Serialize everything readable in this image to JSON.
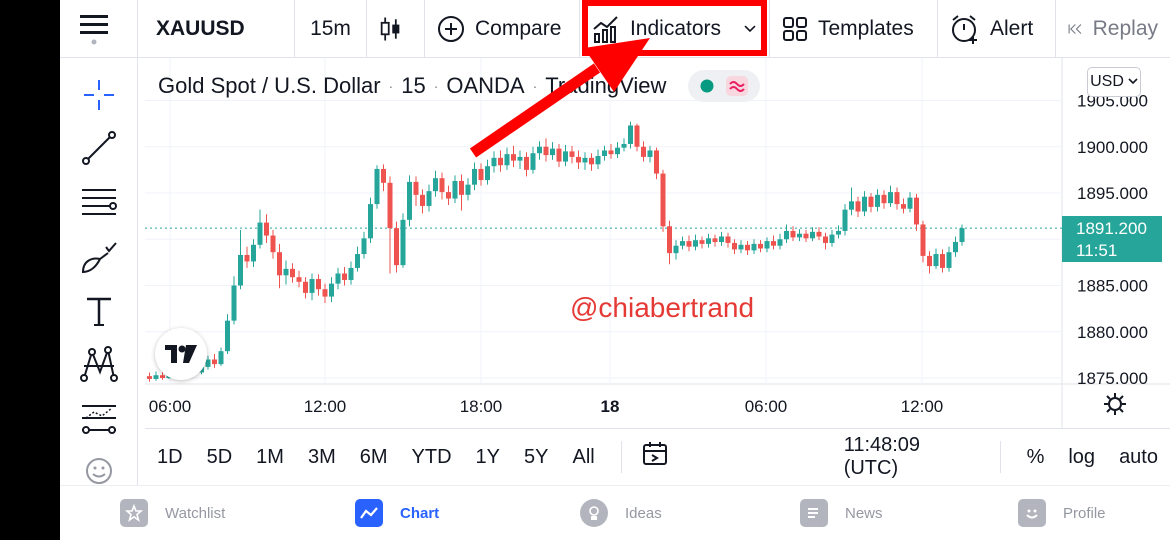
{
  "toolbar": {
    "symbol": "XAUUSD",
    "interval": "15m",
    "compare_label": "Compare",
    "indicators_label": "Indicators",
    "templates_label": "Templates",
    "alert_label": "Alert",
    "replay_label": "Replay"
  },
  "legend": {
    "name": "Gold Spot / U.S. Dollar",
    "interval": "15",
    "exchange": "OANDA",
    "source": "TradingView"
  },
  "currency": "USD",
  "price_axis": [
    "1905.000",
    "1900.000",
    "1895.000",
    "1891.200",
    "1885.000",
    "1880.000",
    "1875.000"
  ],
  "price_axis_ticks": [
    "1905.000",
    "1900.000",
    "1895.000",
    "1885.000",
    "1880.000",
    "1875.000"
  ],
  "time_axis": [
    "06:00",
    "12:00",
    "18:00",
    "18",
    "06:00",
    "12:00"
  ],
  "last_price": {
    "price": "1891.200",
    "countdown": "11:51"
  },
  "watermark": "@chiabertrand",
  "range_buttons": [
    "1D",
    "5D",
    "1M",
    "3M",
    "6M",
    "YTD",
    "1Y",
    "5Y",
    "All"
  ],
  "clock": "11:48:09 (UTC)",
  "scale_options": [
    "%",
    "log",
    "auto"
  ],
  "bottom_nav": [
    "Watchlist",
    "Chart",
    "Ideas",
    "News",
    "Profile"
  ],
  "colors": {
    "up": "#26a69a",
    "down": "#ef5350",
    "accent": "#2962ff",
    "annotation": "#ff0000"
  },
  "icons": [
    "menu-icon",
    "candlestick-icon",
    "plus-circle-icon",
    "indicators-icon",
    "chevron-down-icon",
    "templates-icon",
    "alarm-icon",
    "replay-icon",
    "crosshair-icon",
    "trend-line-icon",
    "fib-icon",
    "brush-icon",
    "text-icon",
    "pattern-icon",
    "prediction-icon",
    "emoji-icon",
    "tradingview-logo-icon",
    "gear-icon",
    "date-range-icon"
  ],
  "chart_data": {
    "type": "candlestick",
    "title": "Gold Spot / U.S. Dollar",
    "x_ticks": [
      "06:00",
      "12:00",
      "18:00",
      "18",
      "06:00",
      "12:00"
    ],
    "ylim": [
      1874,
      1907
    ],
    "y_ticks": [
      1875,
      1880,
      1885,
      1890,
      1895,
      1900,
      1905
    ],
    "last": 1891.2,
    "candles": [
      [
        1875.2,
        1874.9,
        1875.6,
        1874.6
      ],
      [
        1874.9,
        1875.3,
        1875.7,
        1874.7
      ],
      [
        1875.3,
        1875.0,
        1875.8,
        1874.8
      ],
      [
        1875.0,
        1875.5,
        1876.0,
        1874.9
      ],
      [
        1875.5,
        1875.8,
        1876.2,
        1875.2
      ],
      [
        1875.8,
        1875.4,
        1876.1,
        1875.1
      ],
      [
        1875.4,
        1875.9,
        1876.3,
        1875.2
      ],
      [
        1875.9,
        1875.6,
        1876.4,
        1875.3
      ],
      [
        1875.6,
        1876.2,
        1876.8,
        1875.4
      ],
      [
        1876.2,
        1877.0,
        1877.4,
        1875.9
      ],
      [
        1877.0,
        1876.5,
        1877.6,
        1876.1
      ],
      [
        1876.5,
        1877.9,
        1878.3,
        1876.3
      ],
      [
        1877.9,
        1881.2,
        1881.9,
        1877.6
      ],
      [
        1881.2,
        1885.0,
        1886.0,
        1880.8
      ],
      [
        1885.0,
        1888.3,
        1891.0,
        1884.6
      ],
      [
        1888.3,
        1887.6,
        1889.2,
        1886.9
      ],
      [
        1887.6,
        1889.4,
        1890.0,
        1887.0
      ],
      [
        1889.4,
        1891.8,
        1893.2,
        1889.0
      ],
      [
        1891.8,
        1890.4,
        1892.7,
        1889.6
      ],
      [
        1890.4,
        1888.6,
        1891.0,
        1887.9
      ],
      [
        1888.6,
        1886.1,
        1889.5,
        1884.7
      ],
      [
        1886.1,
        1886.8,
        1887.7,
        1885.1
      ],
      [
        1886.8,
        1885.9,
        1887.4,
        1885.3
      ],
      [
        1885.9,
        1885.4,
        1886.6,
        1884.8
      ],
      [
        1885.4,
        1884.2,
        1885.9,
        1883.6
      ],
      [
        1884.2,
        1885.7,
        1886.3,
        1883.4
      ],
      [
        1885.7,
        1884.6,
        1886.2,
        1883.9
      ],
      [
        1884.6,
        1883.8,
        1885.2,
        1883.1
      ],
      [
        1883.8,
        1885.2,
        1885.9,
        1883.2
      ],
      [
        1885.2,
        1886.3,
        1886.9,
        1884.6
      ],
      [
        1886.3,
        1885.6,
        1887.0,
        1885.0
      ],
      [
        1885.6,
        1886.9,
        1887.6,
        1885.1
      ],
      [
        1886.9,
        1888.4,
        1889.2,
        1886.5
      ],
      [
        1888.4,
        1890.1,
        1890.8,
        1887.9
      ],
      [
        1890.1,
        1893.8,
        1894.5,
        1889.6
      ],
      [
        1893.8,
        1897.6,
        1898.0,
        1893.3
      ],
      [
        1897.6,
        1896.1,
        1898.1,
        1895.2
      ],
      [
        1896.1,
        1891.2,
        1896.8,
        1886.3
      ],
      [
        1891.2,
        1887.2,
        1891.9,
        1886.4
      ],
      [
        1887.2,
        1892.1,
        1892.8,
        1886.9
      ],
      [
        1892.1,
        1896.2,
        1896.9,
        1891.4
      ],
      [
        1896.2,
        1894.8,
        1896.8,
        1893.6
      ],
      [
        1894.8,
        1893.6,
        1895.4,
        1892.8
      ],
      [
        1893.6,
        1895.2,
        1895.9,
        1893.0
      ],
      [
        1895.2,
        1896.6,
        1897.4,
        1894.6
      ],
      [
        1896.6,
        1895.1,
        1897.2,
        1894.3
      ],
      [
        1895.1,
        1894.4,
        1895.8,
        1893.7
      ],
      [
        1894.4,
        1896.3,
        1896.9,
        1893.9
      ],
      [
        1896.3,
        1894.8,
        1897.0,
        1893.1
      ],
      [
        1894.8,
        1895.9,
        1896.6,
        1894.2
      ],
      [
        1895.9,
        1897.6,
        1898.3,
        1895.3
      ],
      [
        1897.6,
        1896.4,
        1898.2,
        1895.8
      ],
      [
        1896.4,
        1897.9,
        1898.6,
        1895.9
      ],
      [
        1897.9,
        1898.8,
        1899.5,
        1897.2
      ],
      [
        1898.8,
        1898.0,
        1899.6,
        1897.3
      ],
      [
        1898.0,
        1899.2,
        1899.9,
        1897.5
      ],
      [
        1899.2,
        1898.5,
        1900.1,
        1897.8
      ],
      [
        1898.5,
        1898.9,
        1899.6,
        1897.6
      ],
      [
        1898.9,
        1897.5,
        1899.4,
        1896.8
      ],
      [
        1897.5,
        1899.3,
        1900.0,
        1897.1
      ],
      [
        1899.3,
        1900.0,
        1900.6,
        1898.6
      ],
      [
        1900.0,
        1899.1,
        1900.9,
        1898.4
      ],
      [
        1899.1,
        1899.8,
        1900.5,
        1898.6
      ],
      [
        1899.8,
        1898.4,
        1900.3,
        1897.8
      ],
      [
        1898.4,
        1899.5,
        1900.2,
        1897.9
      ],
      [
        1899.5,
        1898.9,
        1900.1,
        1898.2
      ],
      [
        1898.9,
        1898.3,
        1899.6,
        1897.6
      ],
      [
        1898.3,
        1898.8,
        1899.4,
        1897.5
      ],
      [
        1898.8,
        1898.1,
        1899.3,
        1897.4
      ],
      [
        1898.1,
        1899.0,
        1899.7,
        1897.6
      ],
      [
        1899.0,
        1899.6,
        1900.1,
        1898.5
      ],
      [
        1899.6,
        1899.2,
        1900.3,
        1898.7
      ],
      [
        1899.2,
        1899.9,
        1900.5,
        1898.8
      ],
      [
        1899.9,
        1900.3,
        1900.9,
        1899.5
      ],
      [
        1900.3,
        1902.3,
        1902.7,
        1899.8
      ],
      [
        1902.3,
        1900.0,
        1902.5,
        1899.5
      ],
      [
        1900.0,
        1898.9,
        1900.6,
        1898.4
      ],
      [
        1898.9,
        1899.6,
        1900.1,
        1898.3
      ],
      [
        1899.6,
        1897.1,
        1899.9,
        1896.5
      ],
      [
        1897.1,
        1891.4,
        1897.5,
        1890.8
      ],
      [
        1891.4,
        1888.5,
        1892.0,
        1887.3
      ],
      [
        1888.5,
        1889.3,
        1889.9,
        1887.8
      ],
      [
        1889.3,
        1889.8,
        1890.3,
        1888.9
      ],
      [
        1889.8,
        1889.2,
        1890.4,
        1888.7
      ],
      [
        1889.2,
        1889.9,
        1890.5,
        1888.8
      ],
      [
        1889.9,
        1889.5,
        1890.3,
        1889.0
      ],
      [
        1889.5,
        1890.1,
        1890.6,
        1889.1
      ],
      [
        1890.1,
        1889.7,
        1890.5,
        1889.2
      ],
      [
        1889.7,
        1890.3,
        1890.8,
        1889.3
      ],
      [
        1890.3,
        1889.6,
        1890.7,
        1889.1
      ],
      [
        1889.6,
        1888.9,
        1890.0,
        1888.4
      ],
      [
        1888.9,
        1889.4,
        1889.9,
        1888.5
      ],
      [
        1889.4,
        1888.8,
        1889.8,
        1888.3
      ],
      [
        1888.8,
        1889.5,
        1890.0,
        1888.4
      ],
      [
        1889.5,
        1889.0,
        1889.9,
        1888.6
      ],
      [
        1889.0,
        1889.8,
        1890.2,
        1888.6
      ],
      [
        1889.8,
        1889.3,
        1890.4,
        1888.9
      ],
      [
        1889.3,
        1890.0,
        1890.6,
        1888.9
      ],
      [
        1890.0,
        1890.9,
        1891.6,
        1889.6
      ],
      [
        1890.9,
        1890.2,
        1891.4,
        1889.8
      ],
      [
        1890.2,
        1890.6,
        1891.1,
        1889.8
      ],
      [
        1890.6,
        1890.1,
        1891.0,
        1889.7
      ],
      [
        1890.1,
        1890.8,
        1891.3,
        1889.8
      ],
      [
        1890.8,
        1890.3,
        1891.3,
        1889.9
      ],
      [
        1890.3,
        1889.6,
        1890.7,
        1888.9
      ],
      [
        1889.6,
        1890.5,
        1891.0,
        1889.2
      ],
      [
        1890.5,
        1890.9,
        1891.5,
        1890.1
      ],
      [
        1890.9,
        1893.2,
        1893.8,
        1890.4
      ],
      [
        1893.2,
        1894.1,
        1895.6,
        1892.6
      ],
      [
        1894.1,
        1893.0,
        1894.6,
        1892.4
      ],
      [
        1893.0,
        1894.6,
        1895.2,
        1892.5
      ],
      [
        1894.6,
        1893.5,
        1895.0,
        1892.9
      ],
      [
        1893.5,
        1894.8,
        1895.4,
        1893.0
      ],
      [
        1894.8,
        1893.9,
        1895.3,
        1893.3
      ],
      [
        1893.9,
        1895.1,
        1895.8,
        1893.5
      ],
      [
        1895.1,
        1893.8,
        1895.6,
        1893.2
      ],
      [
        1893.8,
        1893.3,
        1894.4,
        1892.8
      ],
      [
        1893.3,
        1894.5,
        1895.1,
        1892.9
      ],
      [
        1894.5,
        1891.6,
        1894.9,
        1890.9
      ],
      [
        1891.6,
        1888.2,
        1892.0,
        1887.5
      ],
      [
        1888.2,
        1887.1,
        1888.7,
        1886.3
      ],
      [
        1887.1,
        1888.4,
        1889.0,
        1886.8
      ],
      [
        1888.4,
        1886.9,
        1888.9,
        1886.4
      ],
      [
        1886.9,
        1888.6,
        1889.2,
        1886.5
      ],
      [
        1888.6,
        1889.7,
        1890.3,
        1888.1
      ],
      [
        1889.7,
        1891.2,
        1891.6,
        1889.3
      ]
    ]
  }
}
